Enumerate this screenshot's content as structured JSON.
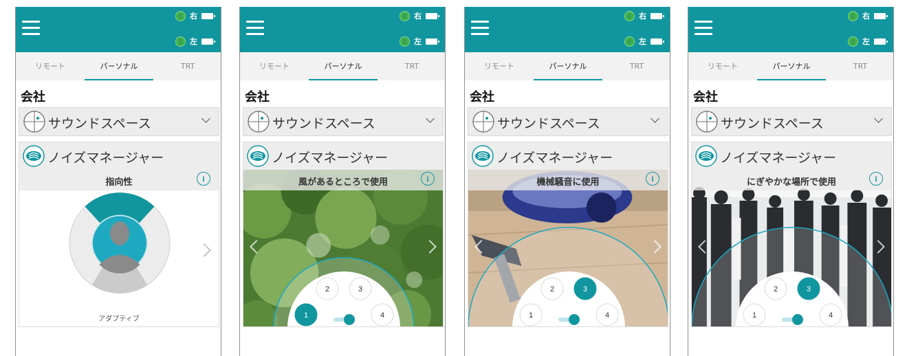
{
  "screens": [
    {
      "header": {
        "right_label": "右",
        "left_label": "左"
      },
      "tabs": [
        "リモート",
        "パーソナル",
        "TRT"
      ],
      "title": "会社",
      "soundspace_label": "サウンドスペース",
      "noise_manager_label": "ノイズマネージャー",
      "mode_title": "指向性",
      "dial_caption": "アダプティブ"
    },
    {
      "header": {
        "right_label": "右",
        "left_label": "左"
      },
      "tabs": [
        "リモート",
        "パーソナル",
        "TRT"
      ],
      "title": "会社",
      "soundspace_label": "サウンドスペース",
      "noise_manager_label": "ノイズマネージャー",
      "mode_title": "風があるところで使用",
      "presets": [
        "1",
        "2",
        "3",
        "4"
      ],
      "selected_preset": "1",
      "slider_value": 0.5
    },
    {
      "header": {
        "right_label": "右",
        "left_label": "左"
      },
      "tabs": [
        "リモート",
        "パーソナル",
        "TRT"
      ],
      "title": "会社",
      "soundspace_label": "サウンドスペース",
      "noise_manager_label": "ノイズマネージャー",
      "mode_title": "機械騒音に使用",
      "presets": [
        "1",
        "2",
        "3",
        "4"
      ],
      "selected_preset": "3",
      "slider_value": 0.5
    },
    {
      "header": {
        "right_label": "右",
        "left_label": "左"
      },
      "tabs": [
        "リモート",
        "パーソナル",
        "TRT"
      ],
      "title": "会社",
      "soundspace_label": "サウンドスペース",
      "noise_manager_label": "ノイズマネージャー",
      "mode_title": "にぎやかな場所で使用",
      "presets": [
        "1",
        "2",
        "3",
        "4"
      ],
      "selected_preset": "3",
      "slider_value": 0.5
    }
  ],
  "colors": {
    "accent": "#11969f",
    "selected_button": "#11969f",
    "header_bg": "#11969f"
  },
  "icons": [
    "menu-icon",
    "bluetooth-icon",
    "battery-icon",
    "soundspace-icon",
    "noise-manager-icon",
    "info-icon",
    "chevron-down-icon",
    "chevron-left-icon",
    "chevron-right-icon",
    "person-silhouette-icon"
  ]
}
